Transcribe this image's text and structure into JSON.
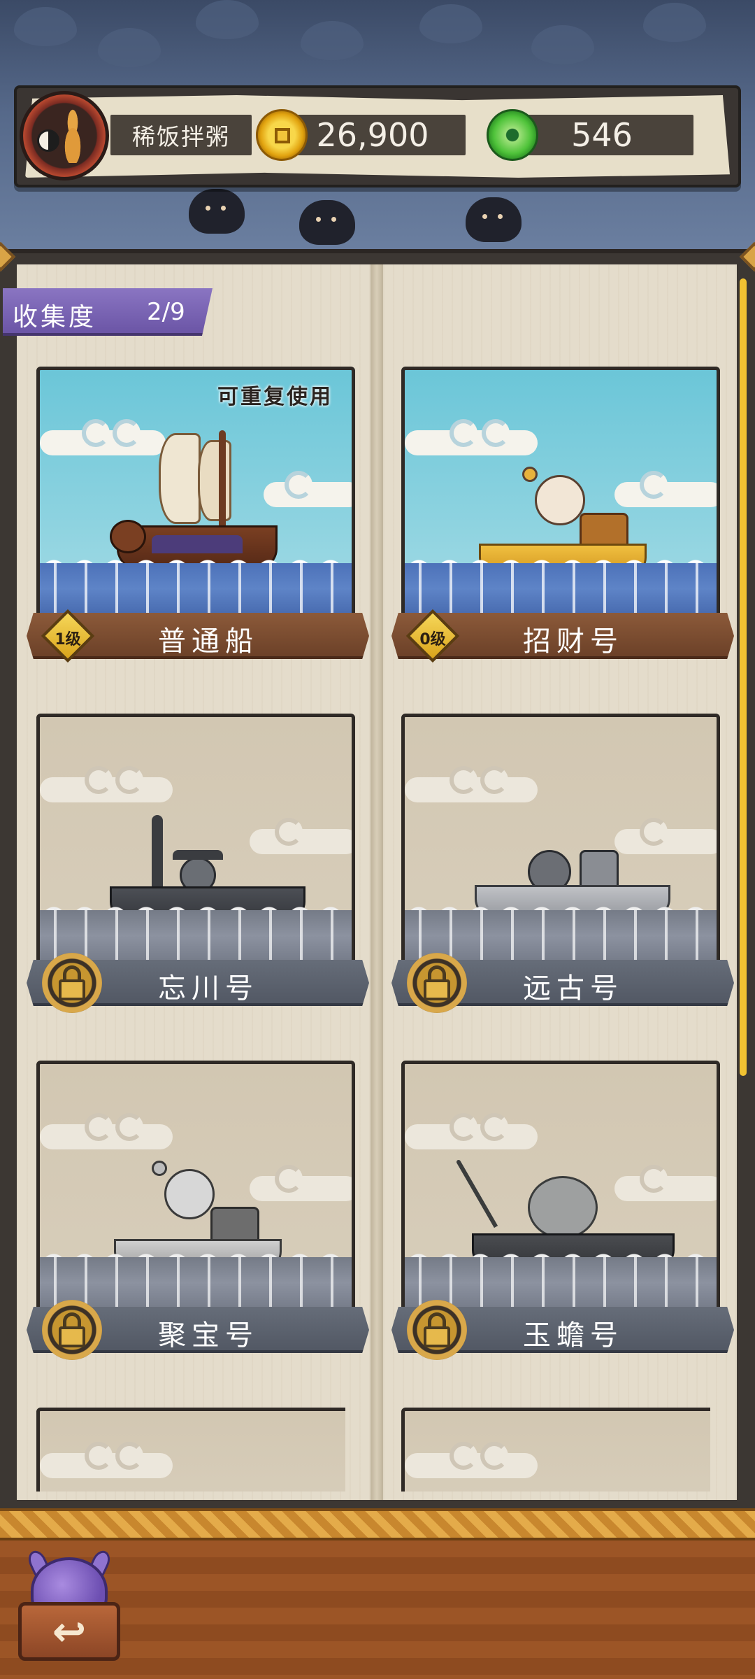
{
  "header": {
    "player_name": "稀饭拌粥",
    "gold": "26,900",
    "jade": "546",
    "icons": {
      "gold": "gold-coin-icon",
      "jade": "jade-coin-icon",
      "avatar": "gourd-avatar"
    }
  },
  "collection": {
    "label": "收集度",
    "value": "2/9"
  },
  "ships": [
    {
      "name": "普通船",
      "level": "1级",
      "tag": "可重复使用",
      "locked": false
    },
    {
      "name": "招财号",
      "level": "0级",
      "locked": false
    },
    {
      "name": "忘川号",
      "locked": true
    },
    {
      "name": "远古号",
      "locked": true
    },
    {
      "name": "聚宝号",
      "locked": true
    },
    {
      "name": "玉蟾号",
      "locked": true
    }
  ],
  "footer": {
    "back_icon": "back-arrow-icon",
    "back_glyph": "↩"
  },
  "colors": {
    "accent_purple": "#6b55a6",
    "gold": "#e2a410",
    "jade": "#4fc33a",
    "banner_unlocked": "#8c5a3a",
    "banner_locked": "#5e6470"
  }
}
